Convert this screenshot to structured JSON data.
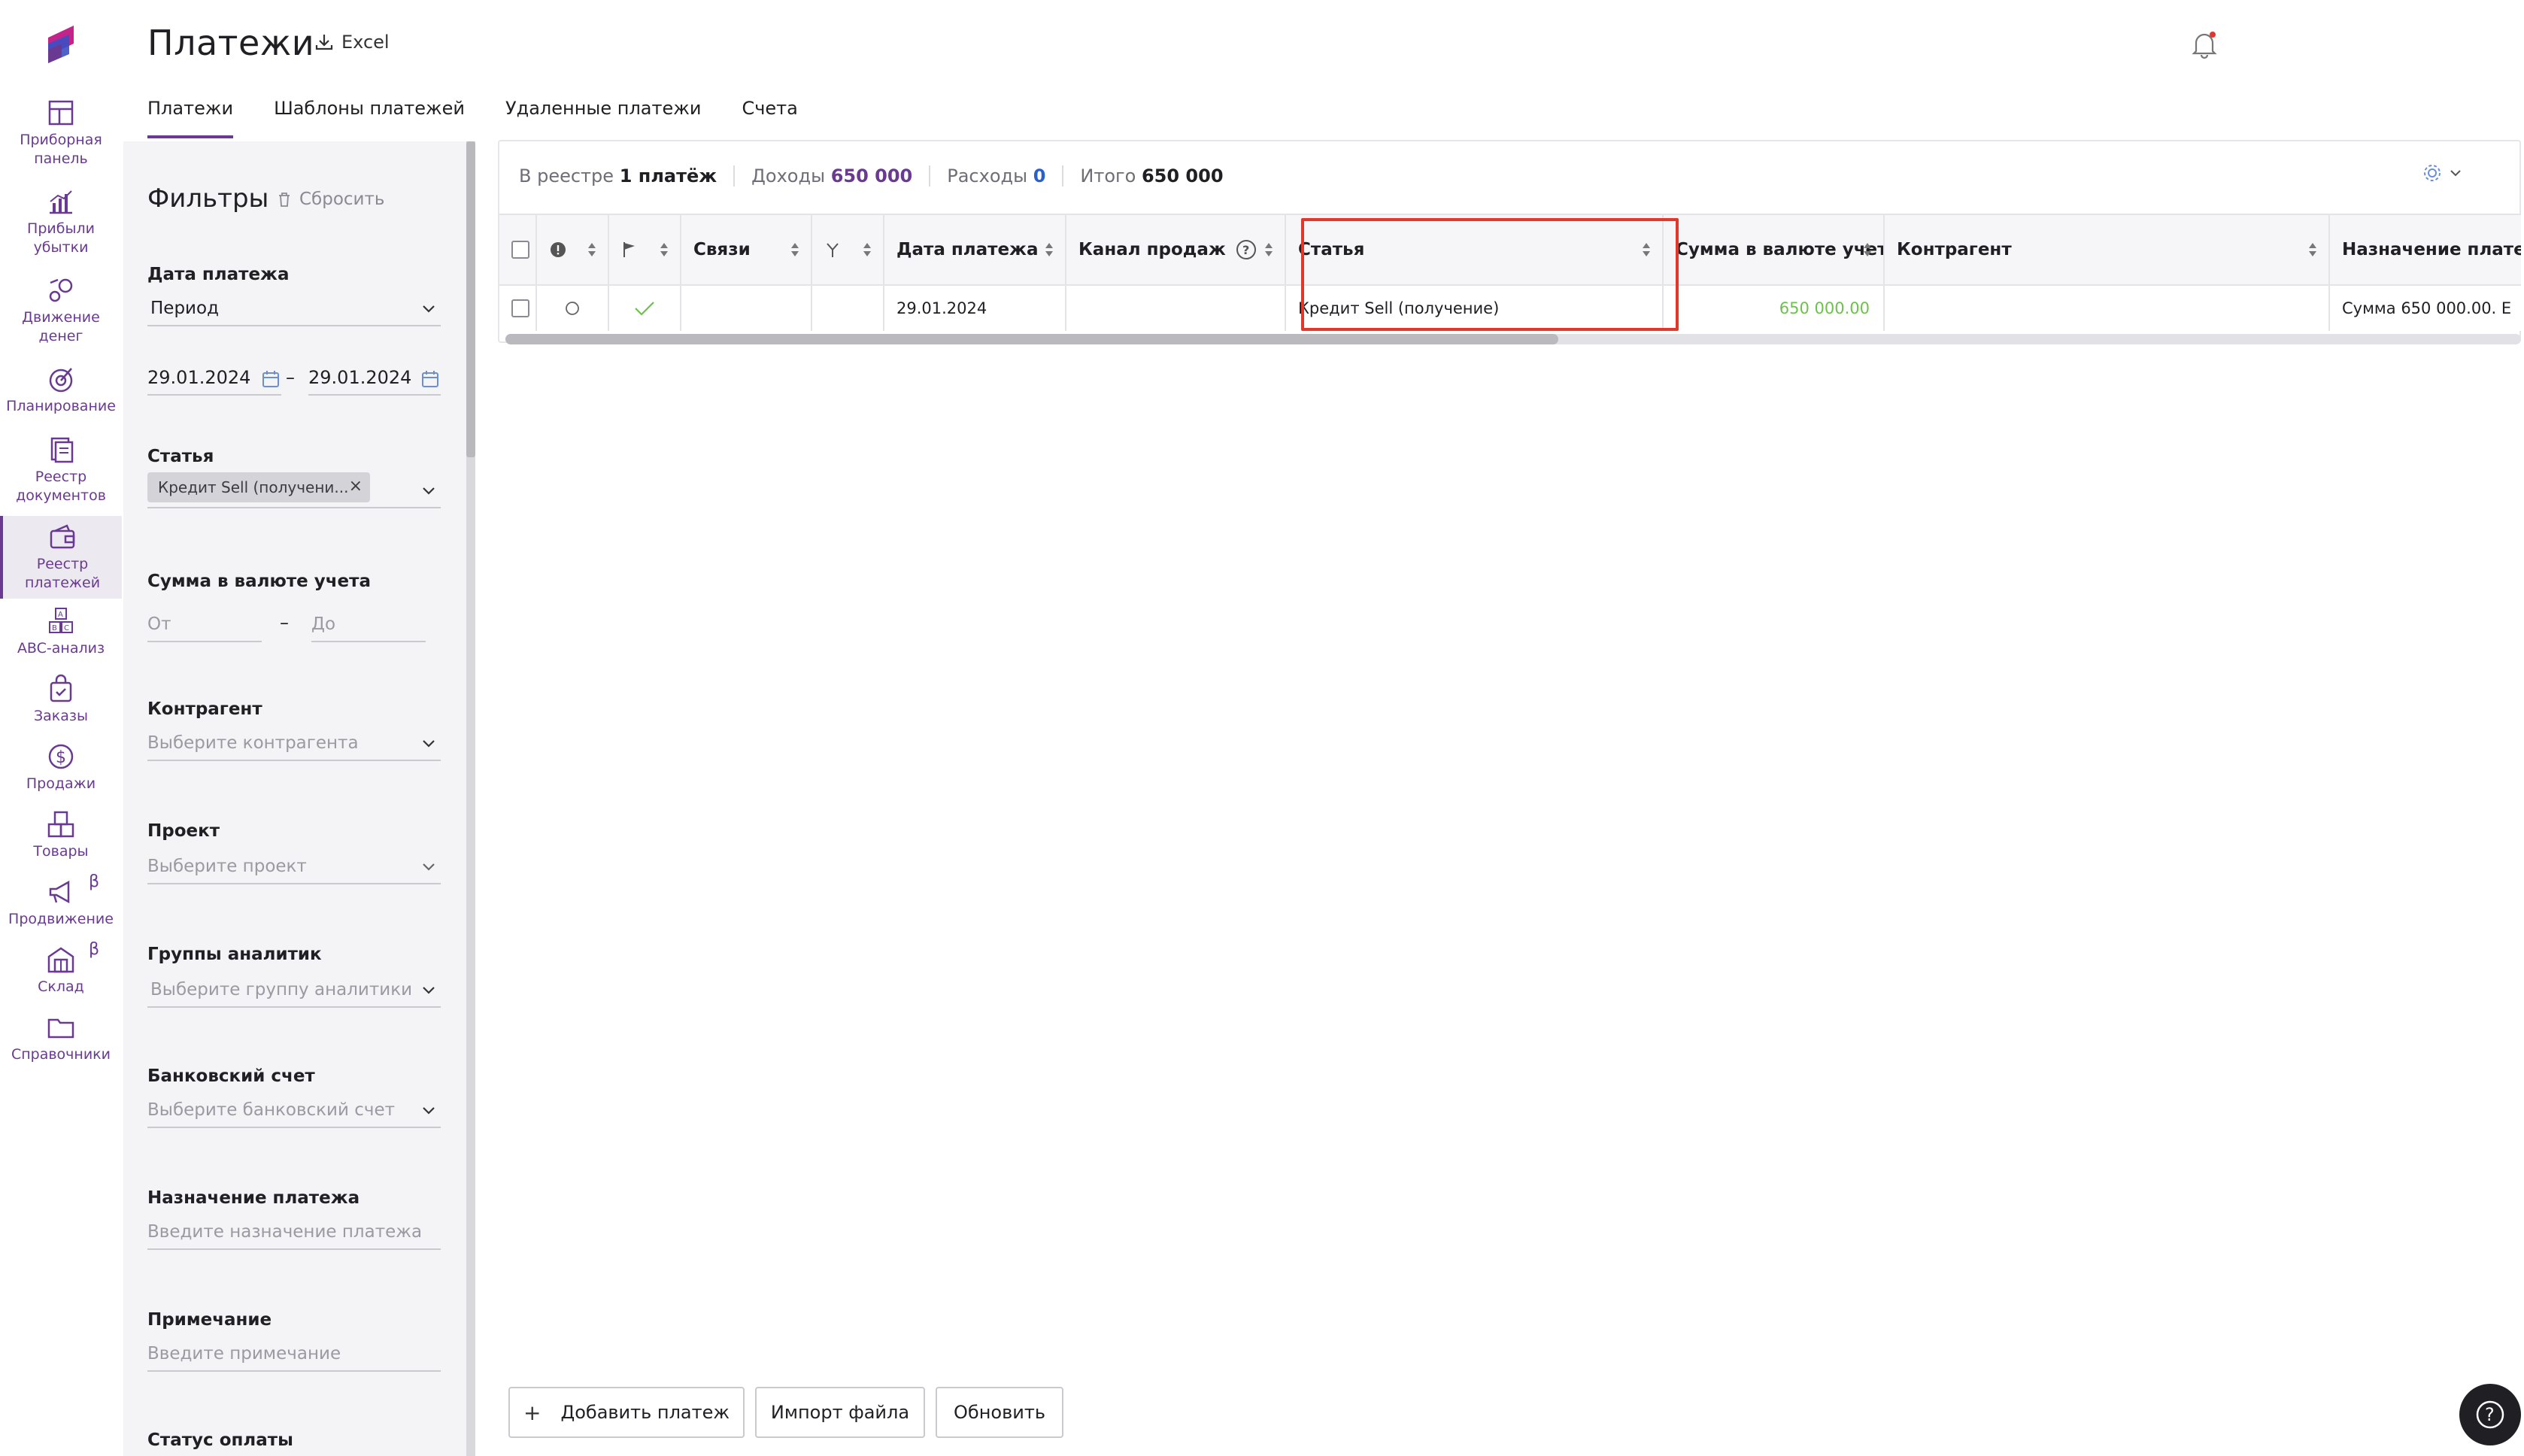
{
  "app": {
    "title": "Платежи",
    "excel_label": "Excel"
  },
  "nav": {
    "items": [
      {
        "label1": "Приборная",
        "label2": "панель",
        "icon": "dashboard-icon"
      },
      {
        "label1": "Прибыли",
        "label2": "убытки",
        "icon": "chart-icon"
      },
      {
        "label1": "Движение",
        "label2": "денег",
        "icon": "money-flow-icon"
      },
      {
        "label1": "Планирование",
        "label2": "",
        "icon": "target-icon"
      },
      {
        "label1": "Реестр",
        "label2": "документов",
        "icon": "documents-icon"
      },
      {
        "label1": "Реестр",
        "label2": "платежей",
        "icon": "wallet-icon",
        "active": true
      },
      {
        "label1": "ABC-анализ",
        "label2": "",
        "icon": "abc-icon"
      },
      {
        "label1": "Заказы",
        "label2": "",
        "icon": "bag-icon"
      },
      {
        "label1": "Продажи",
        "label2": "",
        "icon": "dollar-icon"
      },
      {
        "label1": "Товары",
        "label2": "",
        "icon": "boxes-icon"
      },
      {
        "label1": "Продвижение",
        "label2": "",
        "icon": "megaphone-icon",
        "beta": "β"
      },
      {
        "label1": "Склад",
        "label2": "",
        "icon": "warehouse-icon",
        "beta": "β"
      },
      {
        "label1": "Справочники",
        "label2": "",
        "icon": "folder-icon"
      }
    ]
  },
  "tabs": [
    {
      "label": "Платежи",
      "active": true
    },
    {
      "label": "Шаблоны платежей"
    },
    {
      "label": "Удаленные платежи"
    },
    {
      "label": "Счета"
    }
  ],
  "filters": {
    "title": "Фильтры",
    "reset": "Сбросить",
    "date": {
      "label": "Дата платежа",
      "period": "Период",
      "from": "29.01.2024",
      "dash": "–",
      "to": "29.01.2024"
    },
    "article": {
      "label": "Статья",
      "chip": "Кредит Sell (получени...",
      "chip_remove": "×"
    },
    "amount": {
      "label": "Сумма в валюте учета",
      "from_placeholder": "От",
      "dash": "–",
      "to_placeholder": "До"
    },
    "counterparty": {
      "label": "Контрагент",
      "placeholder": "Выберите контрагента"
    },
    "project": {
      "label": "Проект",
      "placeholder": "Выберите проект"
    },
    "analytics": {
      "label": "Группы аналитик",
      "placeholder": "Выберите группу аналитики"
    },
    "bank": {
      "label": "Банковский счет",
      "placeholder": "Выберите банковский счет"
    },
    "purpose": {
      "label": "Назначение платежа",
      "placeholder": "Введите назначение платежа"
    },
    "note": {
      "label": "Примечание",
      "placeholder": "Введите примечание"
    },
    "status": {
      "label": "Статус оплаты"
    }
  },
  "summary": {
    "registry_prefix": "В реестре",
    "registry_count": "1 платёж",
    "income_label": "Доходы",
    "income_value": "650 000",
    "expense_label": "Расходы",
    "expense_value": "0",
    "total_label": "Итого",
    "total_value": "650 000"
  },
  "table": {
    "headers": {
      "links": "Связи",
      "date": "Дата платежа",
      "channel": "Канал продаж",
      "article": "Статья",
      "amount": "Сумма в валюте учета",
      "counterparty": "Контрагент",
      "purpose": "Назначение плате"
    },
    "rows": [
      {
        "date": "29.01.2024",
        "channel": "",
        "article": "Кредит Sell (получение)",
        "amount": "650 000.00",
        "counterparty": "",
        "purpose": "Сумма 650 000.00. Е"
      }
    ]
  },
  "buttons": {
    "add_icon": "+",
    "add": "Добавить платеж",
    "import": "Импорт файла",
    "refresh": "Обновить"
  },
  "help_icon": "?",
  "colors": {
    "accent": "#6a3a92",
    "income": "#6a3a92",
    "expense": "#2a5fd0",
    "amount_positive": "#6cc24a",
    "highlight": "#e2372b"
  }
}
